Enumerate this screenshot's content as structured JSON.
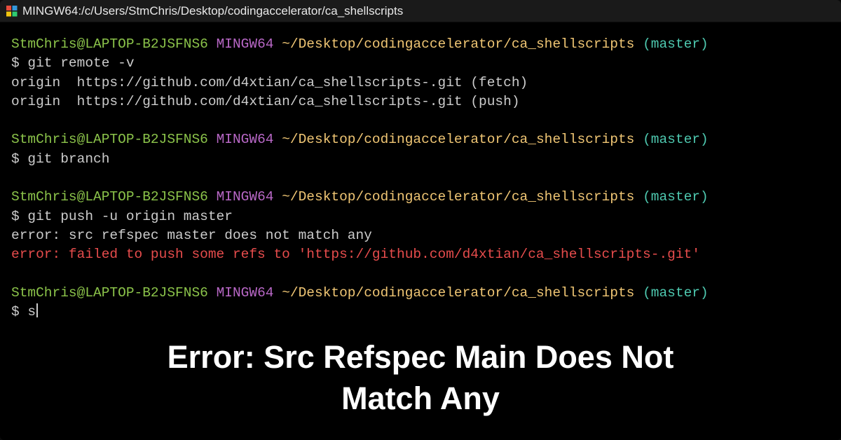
{
  "titlebar": {
    "title": "MINGW64:/c/Users/StmChris/Desktop/codingaccelerator/ca_shellscripts"
  },
  "prompt": {
    "userhost": "StmChris@LAPTOP-B2JSFNS6",
    "env": "MINGW64",
    "path": "~/Desktop/codingaccelerator/ca_shellscripts",
    "branch": "(master)",
    "dollar": "$"
  },
  "block1": {
    "cmd": "git remote -v",
    "out1": "origin  https://github.com/d4xtian/ca_shellscripts-.git (fetch)",
    "out2": "origin  https://github.com/d4xtian/ca_shellscripts-.git (push)"
  },
  "block2": {
    "cmd": "git branch"
  },
  "block3": {
    "cmd": "git push -u origin master",
    "out1": "error: src refspec master does not match any",
    "out2": "error: failed to push some refs to 'https://github.com/d4xtian/ca_shellscripts-.git'"
  },
  "block4": {
    "typed": "s"
  },
  "caption": {
    "line1": "Error: Src Refspec Main Does Not",
    "line2": "Match Any"
  }
}
